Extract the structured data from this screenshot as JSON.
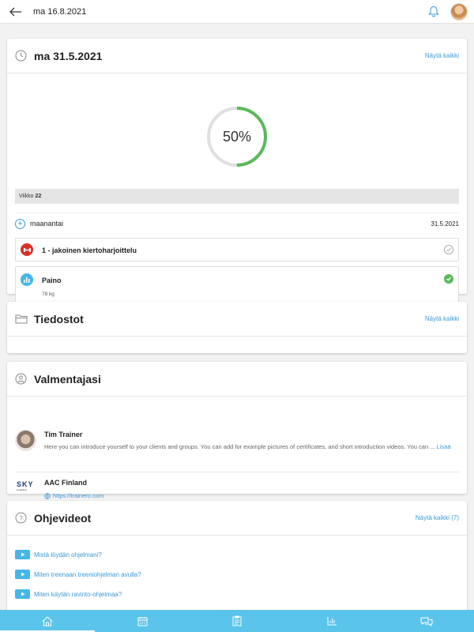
{
  "header": {
    "date": "ma 16.8.2021"
  },
  "day_card": {
    "title": "ma 31.5.2021",
    "link": "Näytä kaikki",
    "progress_label": "50%",
    "progress_fraction": 0.5,
    "week_label": "Viikko",
    "week_number": "22",
    "day_name": "maanantai",
    "day_date": "31.5.2021",
    "items": [
      {
        "name": "1 - jakoinen kiertoharjoittelu",
        "done": false
      },
      {
        "name": "Paino",
        "value": "78 kg",
        "done": true
      }
    ]
  },
  "files_card": {
    "title": "Tiedostot",
    "link": "Näytä kaikki"
  },
  "coach_card": {
    "title": "Valmentajasi",
    "coach": {
      "name": "Tim Trainer",
      "description": "Here you can introduce yourself to your clients and groups. You can add for example pictures of certificates, and short introduction videos. You can ...",
      "more": "Lisää"
    },
    "org": {
      "name": "AAC Finland",
      "logo_text": "SKY",
      "logo_sub": "Coaching",
      "url": "https://trainero.com"
    }
  },
  "videos_card": {
    "title": "Ohjevideot",
    "link": "Näytä kaikki (7)",
    "videos": [
      "Mistä löydän ohjelmani?",
      "Miten treenaan treeniohjelman avulla?",
      "Miten käytän ravinto-ohjelmaa?"
    ]
  },
  "nav": [
    "home-icon",
    "calendar-icon",
    "clipboard-icon",
    "stats-icon",
    "chat-icon"
  ],
  "colors": {
    "accent": "#3a9ad9",
    "nav_bg": "#5bc4ea",
    "progress": "#5cb85c",
    "workout": "#d9302c"
  }
}
